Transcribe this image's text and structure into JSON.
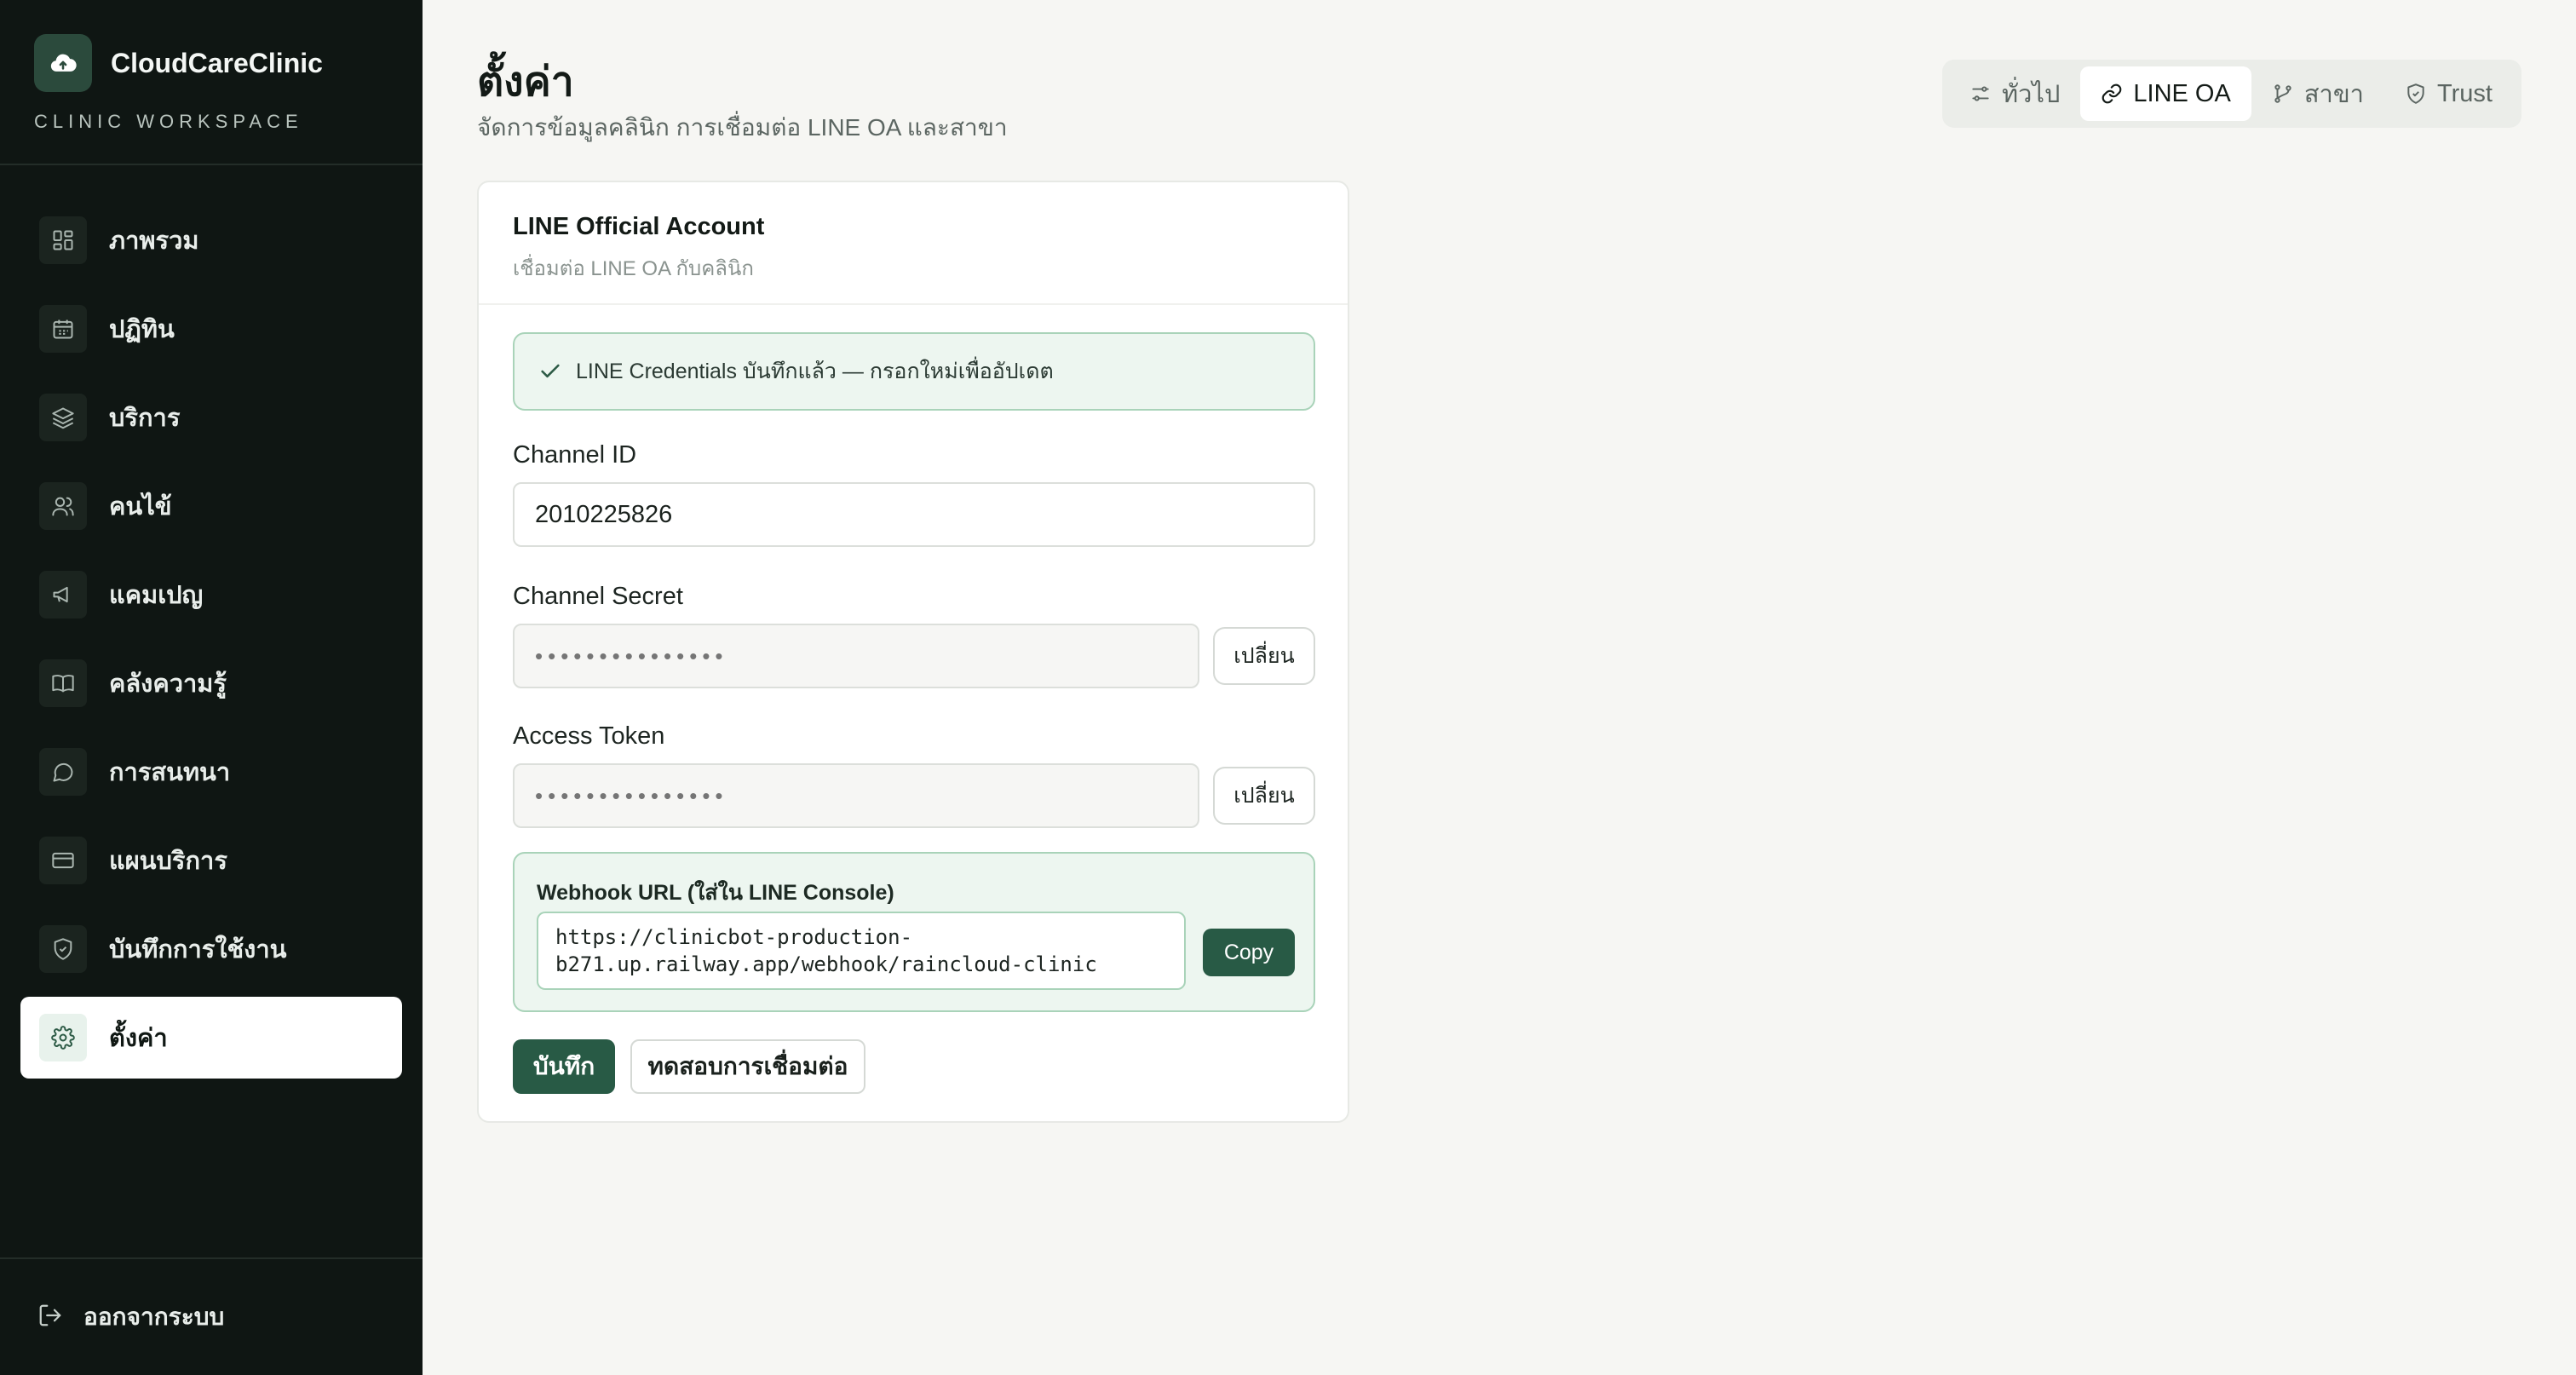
{
  "brand": {
    "name": "CloudCareClinic",
    "subtitle": "CLINIC WORKSPACE",
    "logo_icon": "cloud-icon"
  },
  "sidebar": {
    "items": [
      {
        "label": "ภาพรวม",
        "icon": "dashboard-icon"
      },
      {
        "label": "ปฏิทิน",
        "icon": "calendar-icon"
      },
      {
        "label": "บริการ",
        "icon": "layers-icon"
      },
      {
        "label": "คนไข้",
        "icon": "users-icon"
      },
      {
        "label": "แคมเปญ",
        "icon": "megaphone-icon"
      },
      {
        "label": "คลังความรู้",
        "icon": "book-icon"
      },
      {
        "label": "การสนทนา",
        "icon": "chat-icon"
      },
      {
        "label": "แผนบริการ",
        "icon": "card-icon"
      },
      {
        "label": "บันทึกการใช้งาน",
        "icon": "shield-icon"
      },
      {
        "label": "ตั้งค่า",
        "icon": "gear-icon",
        "active": true
      }
    ],
    "logout_label": "ออกจากระบบ"
  },
  "header": {
    "title": "ตั้งค่า",
    "subtitle": "จัดการข้อมูลคลินิก การเชื่อมต่อ LINE OA และสาขา"
  },
  "tabs": [
    {
      "label": "ทั่วไป",
      "icon": "sliders-icon"
    },
    {
      "label": "LINE OA",
      "icon": "link-icon",
      "active": true
    },
    {
      "label": "สาขา",
      "icon": "branch-icon"
    },
    {
      "label": "Trust",
      "icon": "shield-check-icon"
    }
  ],
  "card": {
    "title": "LINE Official Account",
    "subtitle": "เชื่อมต่อ LINE OA กับคลินิก",
    "alert": "LINE Credentials บันทึกแล้ว — กรอกใหม่เพื่ออัปเดต",
    "channel_id": {
      "label": "Channel ID",
      "value": "2010225826"
    },
    "channel_secret": {
      "label": "Channel Secret",
      "placeholder": "•••••••••••••••",
      "change_label": "เปลี่ยน"
    },
    "access_token": {
      "label": "Access Token",
      "placeholder": "•••••••••••••••",
      "change_label": "เปลี่ยน"
    },
    "webhook": {
      "label": "Webhook URL (ใส่ใน LINE Console)",
      "url": "https://clinicbot-production-b271.up.railway.app/webhook/raincloud-clinic",
      "copy_label": "Copy"
    },
    "save_label": "บันทึก",
    "test_label": "ทดสอบการเชื่อมต่อ"
  },
  "colors": {
    "sidebar_bg": "#0f1613",
    "accent": "#285a45",
    "success_bg": "#edf6f0",
    "success_border": "#a9d3b9",
    "page_bg": "#f6f6f3"
  }
}
